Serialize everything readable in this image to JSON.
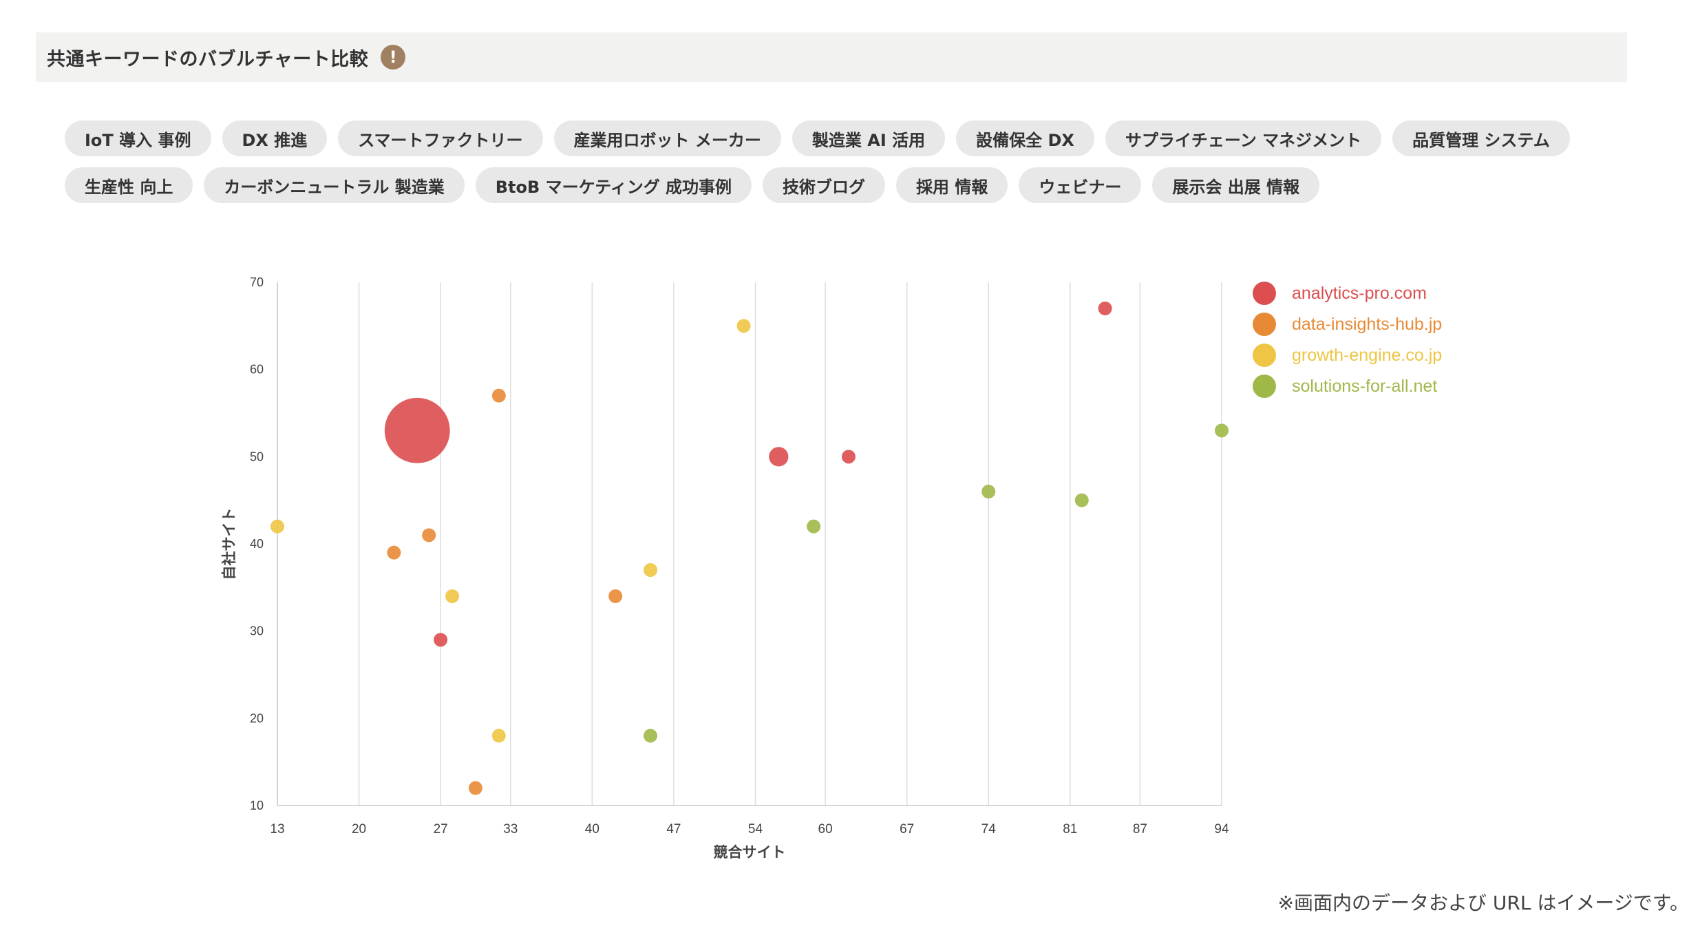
{
  "header": {
    "title": "共通キーワードのバブルチャート比較",
    "info_icon": "exclamation-icon",
    "info_glyph": "!"
  },
  "tags": [
    "IoT 導入 事例",
    "DX 推進",
    "スマートファクトリー",
    "産業用ロボット メーカー",
    "製造業 AI 活用",
    "設備保全 DX",
    "サプライチェーン マネジメント",
    "品質管理 システム",
    "生産性 向上",
    "カーボンニュートラル 製造業",
    "BtoB マーケティング 成功事例",
    "技術ブログ",
    "採用 情報",
    "ウェビナー",
    "展示会 出展 情報"
  ],
  "chart_data": {
    "type": "scatter",
    "subtype": "bubble",
    "xlabel": "競合サイト",
    "ylabel": "自社サイト",
    "xlim": [
      13,
      94
    ],
    "ylim": [
      10,
      70
    ],
    "xticks": [
      13,
      20,
      27,
      33,
      40,
      47,
      54,
      60,
      67,
      74,
      81,
      87,
      94
    ],
    "yticks": [
      10,
      20,
      30,
      40,
      50,
      60,
      70
    ],
    "grid": "vertical",
    "legend_position": "top-right",
    "series": [
      {
        "name": "analytics-pro.com",
        "color": "#dc4e50",
        "points": [
          {
            "x": 25,
            "y": 53,
            "size": 10
          },
          {
            "x": 56,
            "y": 50,
            "size": 2
          },
          {
            "x": 62,
            "y": 50,
            "size": 1
          },
          {
            "x": 84,
            "y": 67,
            "size": 1
          },
          {
            "x": 27,
            "y": 29,
            "size": 1
          }
        ]
      },
      {
        "name": "data-insights-hub.jp",
        "color": "#e88a35",
        "points": [
          {
            "x": 32,
            "y": 57,
            "size": 1
          },
          {
            "x": 26,
            "y": 41,
            "size": 1
          },
          {
            "x": 23,
            "y": 39,
            "size": 1
          },
          {
            "x": 42,
            "y": 34,
            "size": 1
          },
          {
            "x": 30,
            "y": 12,
            "size": 1
          }
        ]
      },
      {
        "name": "growth-engine.co.jp",
        "color": "#eec544",
        "points": [
          {
            "x": 53,
            "y": 65,
            "size": 1
          },
          {
            "x": 13,
            "y": 42,
            "size": 1
          },
          {
            "x": 45,
            "y": 37,
            "size": 1
          },
          {
            "x": 28,
            "y": 34,
            "size": 1
          },
          {
            "x": 32,
            "y": 18,
            "size": 1
          }
        ]
      },
      {
        "name": "solutions-for-all.net",
        "color": "#9fb848",
        "points": [
          {
            "x": 94,
            "y": 53,
            "size": 1
          },
          {
            "x": 74,
            "y": 46,
            "size": 1
          },
          {
            "x": 82,
            "y": 45,
            "size": 1
          },
          {
            "x": 59,
            "y": 42,
            "size": 1
          },
          {
            "x": 45,
            "y": 18,
            "size": 1
          }
        ]
      }
    ]
  },
  "note": "※画面内のデータおよび URL はイメージです。"
}
